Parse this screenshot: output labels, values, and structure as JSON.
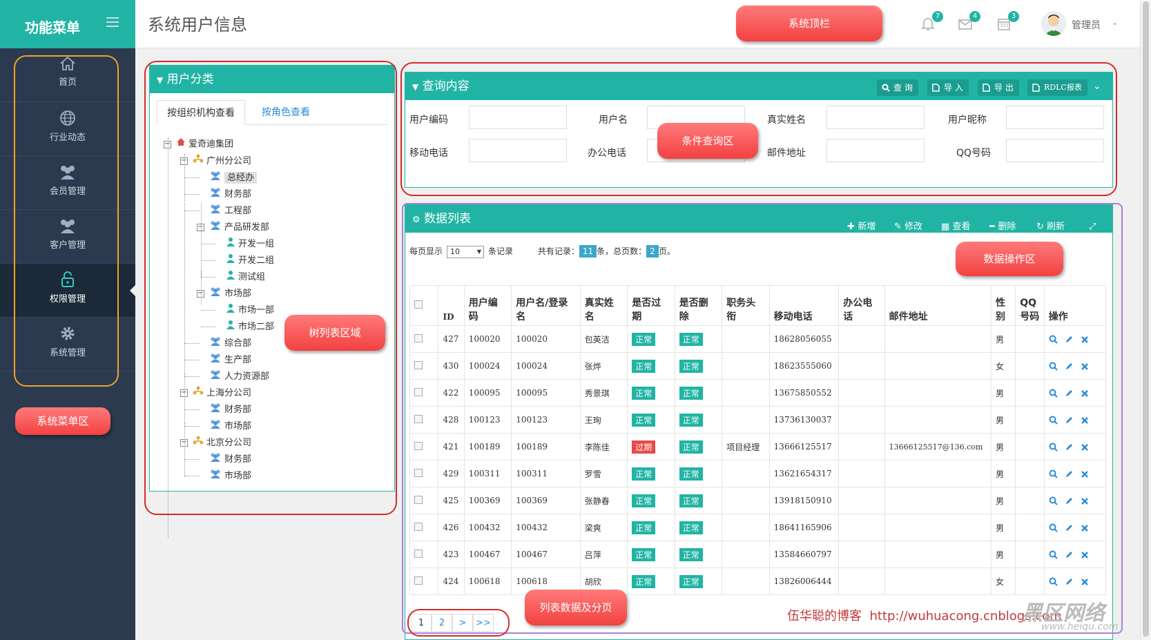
{
  "sidebar": {
    "title": "功能菜单",
    "items": [
      {
        "label": "首页",
        "icon": "home-icon"
      },
      {
        "label": "行业动态",
        "icon": "globe-icon"
      },
      {
        "label": "会员管理",
        "icon": "users-icon"
      },
      {
        "label": "客户管理",
        "icon": "users-icon"
      },
      {
        "label": "权限管理",
        "icon": "unlock-icon"
      },
      {
        "label": "系统管理",
        "icon": "gear-icon"
      }
    ],
    "active": "权限管理"
  },
  "header": {
    "title": "系统用户信息",
    "bell_count": "7",
    "mail_count": "4",
    "calendar_count": "3",
    "user": "管理员"
  },
  "tree_panel": {
    "title": "用户分类",
    "tabs": [
      "按组织机构查看",
      "按角色查看"
    ],
    "nodes": [
      "爱奇迪集团",
      "广州分公司",
      "总经办",
      "财务部",
      "工程部",
      "产品研发部",
      "开发一组",
      "开发二组",
      "测试组",
      "市场部",
      "市场一部",
      "市场二部",
      "综合部",
      "生产部",
      "人力资源部",
      "上海分公司",
      "财务部",
      "市场部",
      "北京分公司",
      "财务部",
      "市场部"
    ]
  },
  "query_panel": {
    "title": "查询内容",
    "buttons": [
      "查 询",
      "导 入",
      "导 出",
      "RDLC报表"
    ],
    "fields": [
      "用户编码",
      "用户名",
      "真实姓名",
      "用户昵称",
      "移动电话",
      "办公电话",
      "邮件地址",
      "QQ号码"
    ]
  },
  "data_panel": {
    "title": "数据列表",
    "actions": [
      "新增",
      "修改",
      "查看",
      "删除",
      "刷新"
    ],
    "pager": {
      "prefix": "每页显示",
      "page_size": "10",
      "suffix": "条记录",
      "total_label": "共有记录：",
      "total": "11",
      "total_suffix": "条，总页数：",
      "pages": "2",
      "pages_suffix": "页。"
    },
    "columns": [
      "ID",
      "用户编码",
      "用户名/登录名",
      "真实姓名",
      "是否过期",
      "是否删除",
      "职务头衔",
      "移动电话",
      "办公电话",
      "邮件地址",
      "性别",
      "QQ号码",
      "操作"
    ],
    "rows": [
      [
        "427",
        "100020",
        "100020",
        "包英洁",
        "正常",
        "正常",
        "",
        "18628056055",
        "",
        "",
        "男",
        ""
      ],
      [
        "430",
        "100024",
        "100024",
        "张烨",
        "正常",
        "正常",
        "",
        "18623555060",
        "",
        "",
        "女",
        ""
      ],
      [
        "422",
        "100095",
        "100095",
        "秀景琪",
        "正常",
        "正常",
        "",
        "13675850552",
        "",
        "",
        "男",
        ""
      ],
      [
        "428",
        "100123",
        "100123",
        "王珣",
        "正常",
        "正常",
        "",
        "13736130037",
        "",
        "",
        "男",
        ""
      ],
      [
        "421",
        "100189",
        "100189",
        "李陈佳",
        "过期",
        "正常",
        "项目经理",
        "13666125517",
        "",
        "13666125517@136.com",
        "男",
        ""
      ],
      [
        "429",
        "100311",
        "100311",
        "罗雪",
        "正常",
        "正常",
        "",
        "13621654317",
        "",
        "",
        "男",
        ""
      ],
      [
        "425",
        "100369",
        "100369",
        "张静春",
        "正常",
        "正常",
        "",
        "13918150910",
        "",
        "",
        "男",
        ""
      ],
      [
        "426",
        "100432",
        "100432",
        "梁爽",
        "正常",
        "正常",
        "",
        "18641165906",
        "",
        "",
        "男",
        ""
      ],
      [
        "423",
        "100467",
        "100467",
        "吕萍",
        "正常",
        "正常",
        "",
        "13584660797",
        "",
        "",
        "男",
        ""
      ],
      [
        "424",
        "100618",
        "100618",
        "胡欣",
        "正常",
        "正常",
        "",
        "13826006444",
        "",
        "",
        "女",
        ""
      ]
    ],
    "pages": [
      "1",
      "2",
      ">",
      ">>"
    ]
  },
  "annotations": {
    "top": "系统顶栏",
    "menu": "系统菜单区",
    "tree": "树列表区域",
    "query": "条件查询区",
    "ops": "数据操作区",
    "list": "列表数据及分页"
  },
  "footer": {
    "blog_label": "伍华聪的博客",
    "blog_url": "http://wuhuacong.cnblogs.com",
    "watermark": "黑区网络",
    "watermark_url": "www.heiqu.com"
  }
}
